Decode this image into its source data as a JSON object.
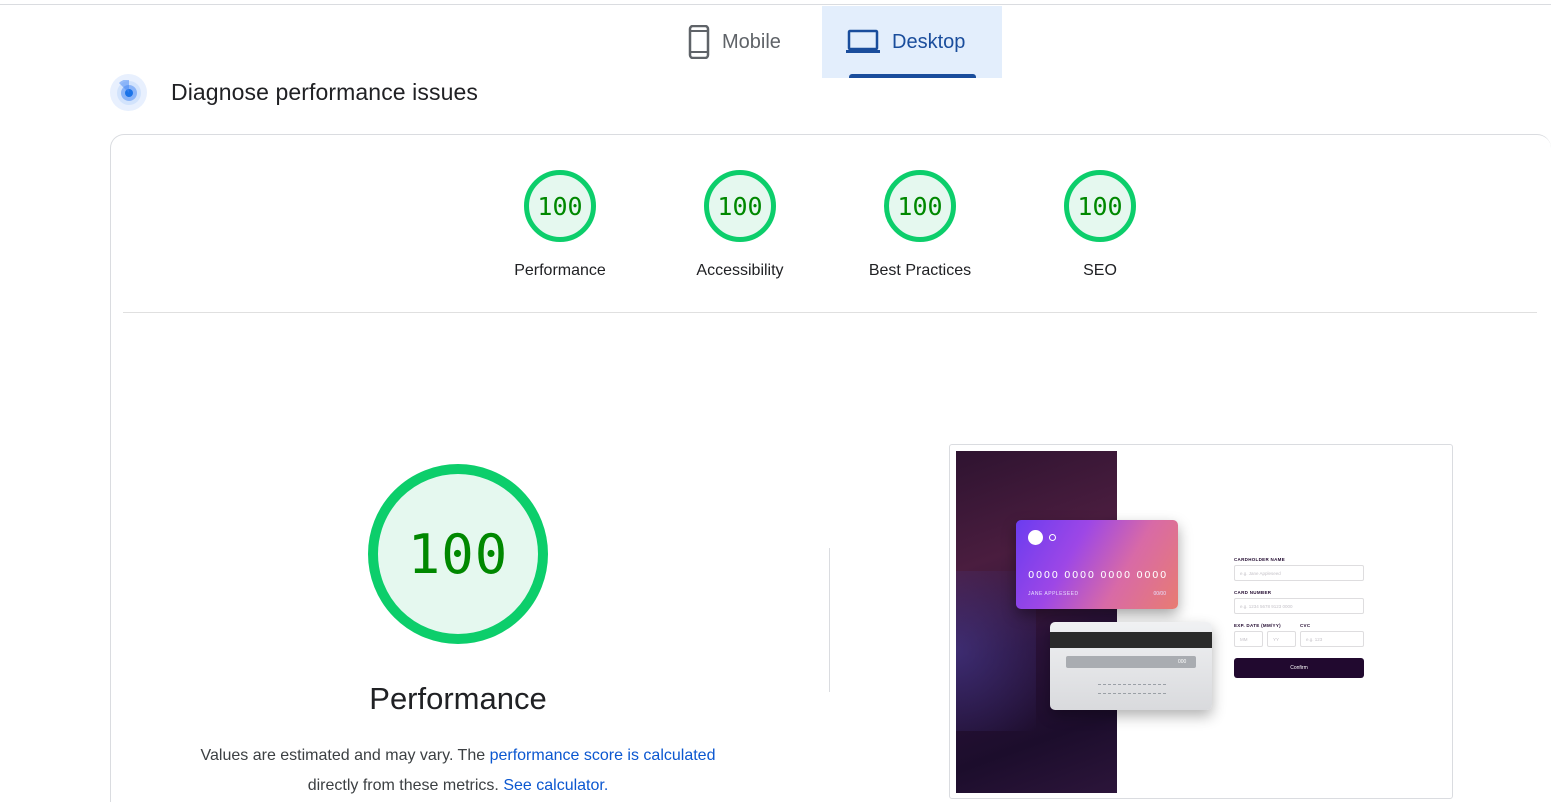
{
  "tabs": [
    {
      "label": "Mobile",
      "icon": "smartphone-icon",
      "selected": false
    },
    {
      "label": "Desktop",
      "icon": "laptop-icon",
      "selected": true
    }
  ],
  "section": {
    "title": "Diagnose performance issues",
    "icon": "radar-icon"
  },
  "categories": [
    {
      "score": "100",
      "label": "Performance"
    },
    {
      "score": "100",
      "label": "Accessibility"
    },
    {
      "score": "100",
      "label": "Best Practices"
    },
    {
      "score": "100",
      "label": "SEO"
    }
  ],
  "performance": {
    "score": "100",
    "title": "Performance",
    "desc_prefix": "Values are estimated and may vary. The",
    "link_score": "performance score is calculated",
    "desc_middle": "directly from these metrics.",
    "link_calculator": "See calculator."
  },
  "screenshot": {
    "card_number": "0000 0000 0000 0000",
    "card_name": "JANE APPLESEED",
    "card_exp": "00/00",
    "card_cvc": "000",
    "form": {
      "name_label": "CARDHOLDER NAME",
      "name_placeholder": "e.g. Jane Appleseed",
      "number_label": "CARD NUMBER",
      "number_placeholder": "e.g. 1234 5678 9123 0000",
      "exp_label": "EXP. DATE (MM/YY)",
      "mm_placeholder": "MM",
      "yy_placeholder": "YY",
      "cvc_label": "CVC",
      "cvc_placeholder": "e.g. 123",
      "button": "Confirm"
    }
  },
  "colors": {
    "pass": "#0cce6b",
    "pass_text": "#008800",
    "pass_bg": "#e5f8ef",
    "link": "#0b57d0",
    "tab_selected": "#1a4d9c"
  }
}
